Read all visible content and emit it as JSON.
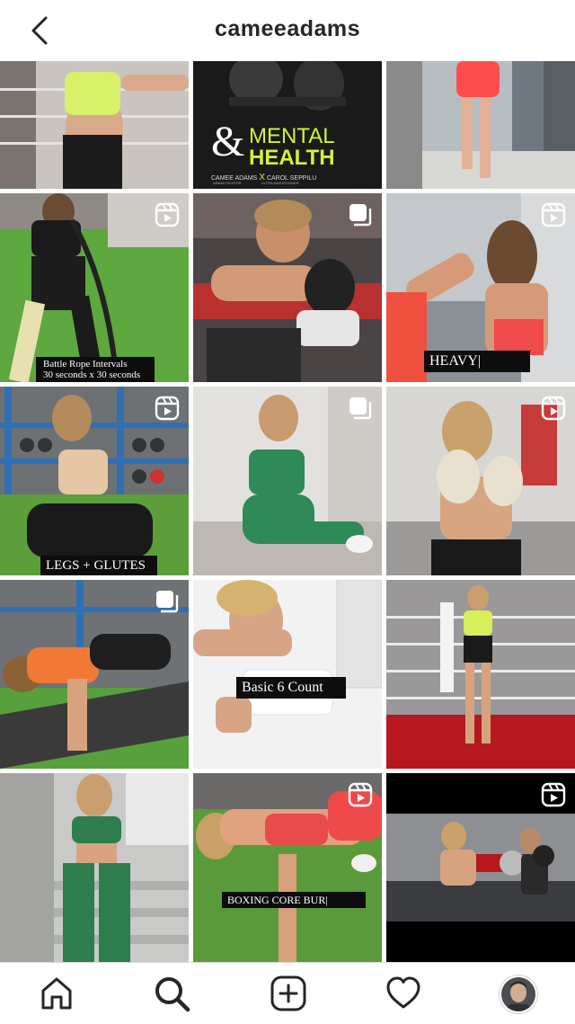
{
  "header": {
    "username": "cameeadams"
  },
  "posts": {
    "p2": {
      "title_amp": "&",
      "title_line1": "MENTAL",
      "title_line2": "HEALTH",
      "credit_left": "CAMEE ADAMS",
      "credit_x": "X",
      "credit_right": "CAROL SEPPILU",
      "sub_left": "WMMA FIGHTER",
      "sub_right": "ULTRA MARATHONER"
    },
    "p4": {
      "caption_line1": "Battle Rope Intervals",
      "caption_line2": "30 seconds x 30 seconds"
    },
    "p6": {
      "caption": "HEAVY|"
    },
    "p7": {
      "caption": "LEGS + GLUTES"
    },
    "p11": {
      "caption": "Basic 6 Count"
    },
    "p14": {
      "caption": "BOXING CORE BUR|"
    }
  },
  "colors": {
    "text": "#262626",
    "reel_badge": "#ffffff",
    "grid_gap": "#ffffff"
  },
  "icons": {
    "back": "chevron-left-icon",
    "reel": "reel-icon",
    "carousel": "carousel-icon",
    "home": "home-icon",
    "search": "search-icon",
    "new_post": "plus-square-icon",
    "activity": "heart-icon",
    "profile": "profile-avatar"
  }
}
